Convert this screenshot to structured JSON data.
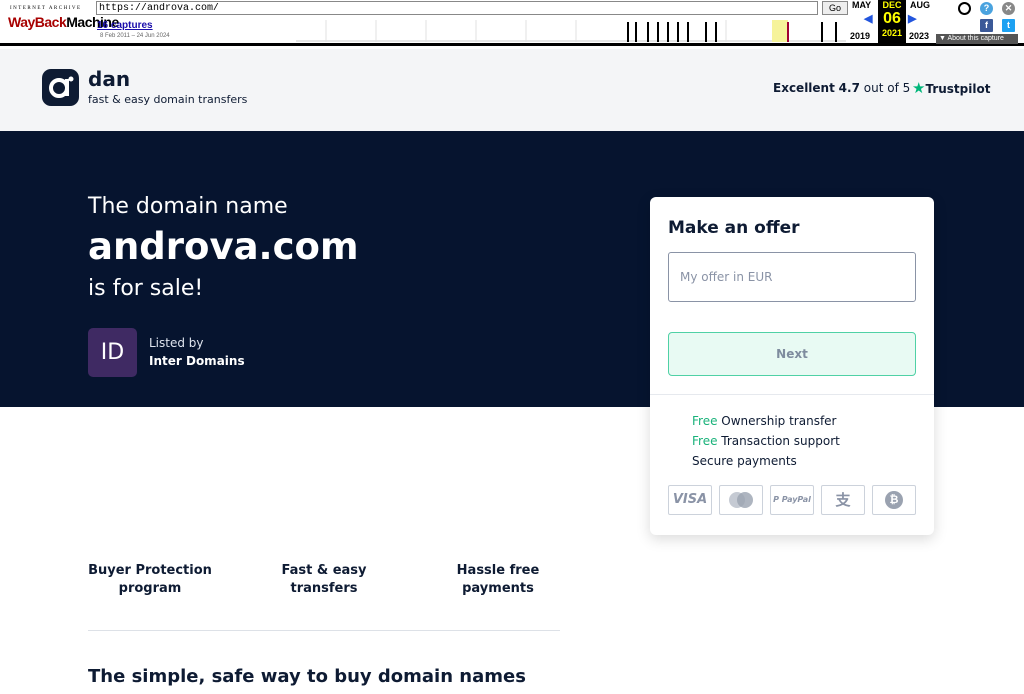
{
  "wayback": {
    "logo_top": "INTERNET ARCHIVE",
    "logo_wayback": "WayBack",
    "logo_machine": "Machine",
    "url_value": "https://androva.com/",
    "go_label": "Go",
    "captures_link": "16 captures",
    "date_range": "8 Feb 2011 – 24 Jun 2024",
    "prev_month": "MAY",
    "current_month": "DEC",
    "next_month": "AUG",
    "prev_year": "2019",
    "current_day": "06",
    "current_year": "2021",
    "next_year": "2023",
    "about_label": "About this capture",
    "help_glyph": "?",
    "close_glyph": "✕",
    "facebook_glyph": "f",
    "twitter_glyph": "t",
    "prev_arrow": "◀",
    "next_arrow": "▶",
    "about_arrow": "▼"
  },
  "header": {
    "brand_name": "dan",
    "brand_tagline": "fast & easy domain transfers",
    "rating_label": "Excellent",
    "rating_value": "4.7",
    "rating_suffix": "out of 5",
    "trustpilot_label": "Trustpilot",
    "trustpilot_star": "★"
  },
  "hero": {
    "pre_title": "The domain name",
    "domain": "androva.com",
    "post_title": "is for sale!",
    "seller_initials": "ID",
    "listed_by_label": "Listed by",
    "seller_name": "Inter Domains"
  },
  "offer_card": {
    "title": "Make an offer",
    "input_placeholder": "My offer in EUR",
    "next_label": "Next",
    "features": [
      {
        "free": "Free",
        "text": "Ownership transfer"
      },
      {
        "free": "Free",
        "text": "Transaction support"
      },
      {
        "free": "",
        "text": "Secure payments"
      }
    ],
    "payment_methods": [
      "VISA",
      "mastercard",
      "PayPal",
      "alipay",
      "bitcoin"
    ],
    "payment_glyphs": [
      "VISA",
      "",
      "P PayPal",
      "支",
      "₿"
    ]
  },
  "perks": [
    {
      "line1": "Buyer Protection",
      "line2": "program"
    },
    {
      "line1": "Fast & easy",
      "line2": "transfers"
    },
    {
      "line1": "Hassle free",
      "line2": "payments"
    }
  ],
  "bottom_heading": "The simple, safe way to buy domain names",
  "colors": {
    "navy": "#06142f",
    "green": "#19b27a",
    "avatar": "#3f2a63",
    "trustpilot": "#00b67a"
  }
}
